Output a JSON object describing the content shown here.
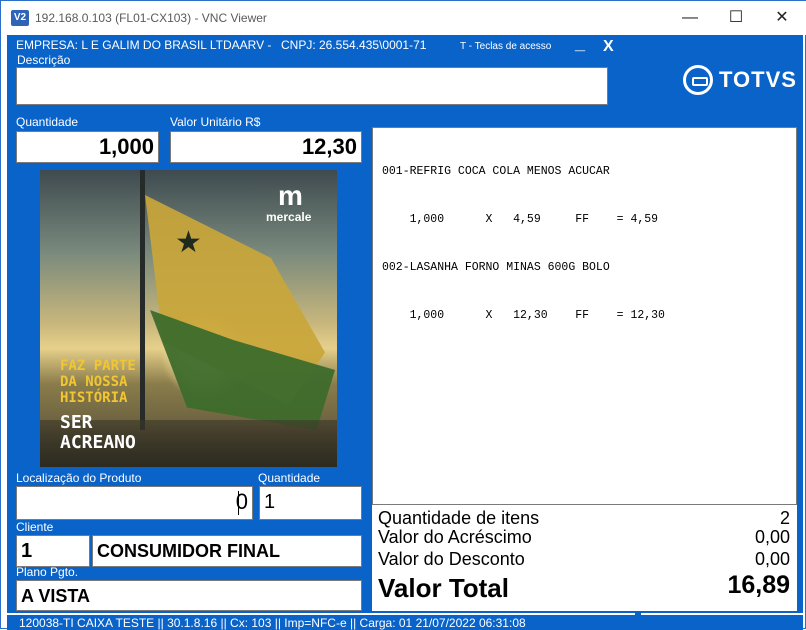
{
  "window": {
    "app_icon": "V2",
    "title": "192.168.0.103 (FL01-CX103) - VNC Viewer",
    "minimize": "—",
    "maximize": "☐",
    "close": "✕"
  },
  "header": {
    "company": "EMPRESA: L E GALIM DO BRASIL LTDAARV  -",
    "cnpj": "CNPJ: 26.554.435\\0001-71",
    "shortcut_hint": "T - Teclas de acesso",
    "minimize_label": "_",
    "close_label": "X",
    "description_label": "Descrição",
    "description_value": "",
    "brand": "TOTVS"
  },
  "item_entry": {
    "quantity_label": "Quantidade",
    "quantity_value": "1,000",
    "unit_price_label": "Valor Unitário R$",
    "unit_price_value": "12,30"
  },
  "banner": {
    "brand_mark": "m",
    "brand_name": "mercale",
    "slogan": "FAZ PARTE\nDA NOSSA\nHISTÓRIA",
    "tagline": "SER\nACREANO"
  },
  "product_lookup": {
    "location_label": "Localização do Produto",
    "location_value": "0",
    "quantity_label": "Quantidade",
    "quantity_value": "1"
  },
  "customer": {
    "label": "Cliente",
    "code": "1",
    "name": "CONSUMIDOR FINAL"
  },
  "payment": {
    "label": "Plano Pgto.",
    "value": "A VISTA"
  },
  "receipt": {
    "lines": [
      "001-REFRIG COCA COLA MENOS ACUCAR",
      "    1,000      X   4,59     FF    = 4,59",
      "002-LASANHA FORNO MINAS 600G BOLO",
      "    1,000      X   12,30    FF    = 12,30"
    ]
  },
  "totals": {
    "items_label": "Quantidade de itens",
    "items_value": "2",
    "surcharge_label": "Valor do Acréscimo",
    "surcharge_value": "0,00",
    "discount_label": "Valor do Desconto",
    "discount_value": "0,00",
    "total_label": "Valor Total",
    "total_value": "16,89"
  },
  "status_bar": {
    "text": "120038-TI CAIXA TESTE || 30.1.8.16 || Cx: 103 || Imp=NFC-e || Carga: 01 21/07/2022 06:31:08"
  }
}
